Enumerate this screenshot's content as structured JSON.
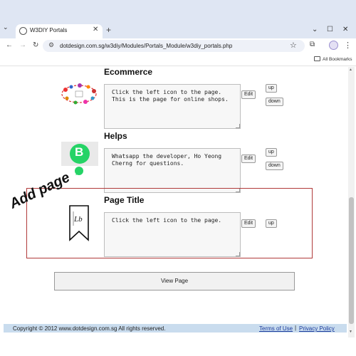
{
  "browser": {
    "tab_title": "W3DIY Portals",
    "url": "dotdesign.com.sg/w3diy/Modules/Portals_Module/w3diy_portals.php",
    "bookmarks_label": "All Bookmarks"
  },
  "annotation": {
    "label": "Add page",
    "color": "#b03a3a"
  },
  "sections": [
    {
      "title": "Ecommerce",
      "description": "Click the left icon to the page.\nThis is the page for online shops.",
      "icon": "ecommerce-icon",
      "edit_label": "Edit",
      "up_label": "up",
      "down_label": "down"
    },
    {
      "title": "Helps",
      "description": "Whatsapp the developer, Ho Yeong\nCherng for questions.",
      "icon": "whatsapp-business-icon",
      "icon_letter": "B",
      "edit_label": "Edit",
      "up_label": "up",
      "down_label": "down"
    },
    {
      "title": "Page Title",
      "description": "Click the left icon to the page.",
      "icon": "bookmark-ribbon-icon",
      "edit_label": "Edit",
      "up_label": "up"
    }
  ],
  "view_page_label": "View Page",
  "footer": {
    "copyright": "Copyright © 2012 www.dotdesign.com.sg  All rights reserved.",
    "terms": "Terms of Use",
    "separator": "|",
    "privacy": "Privacy Policy"
  },
  "colors": {
    "footer_bg": "#c9dcee",
    "link": "#1a3a9c",
    "whatsapp_green": "#25d366"
  }
}
